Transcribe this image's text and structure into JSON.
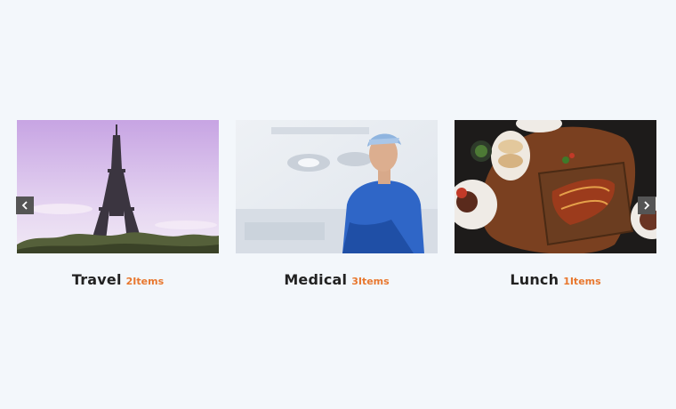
{
  "carousel": {
    "cards": [
      {
        "name": "Travel",
        "count": "2Items",
        "image": "eiffel-tower-photo"
      },
      {
        "name": "Medical",
        "count": "3Items",
        "image": "surgeon-photo"
      },
      {
        "name": "Lunch",
        "count": "1Items",
        "image": "food-table-photo"
      }
    ],
    "prev_icon": "chevron-left-icon",
    "next_icon": "chevron-right-icon"
  },
  "colors": {
    "background": "#f3f7fb",
    "accent": "#e8772e",
    "title": "#222222",
    "arrow_bg": "#555555"
  }
}
